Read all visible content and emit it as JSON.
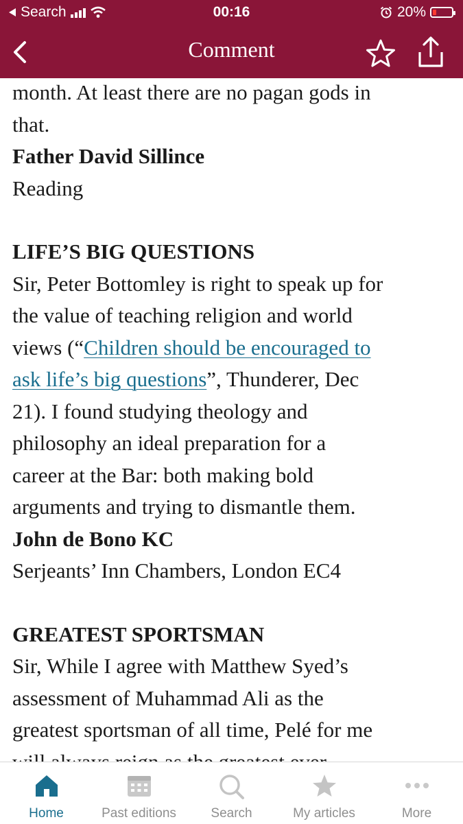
{
  "status_bar": {
    "back_app": "Search",
    "time": "00:16",
    "battery_percent": "20%",
    "battery_level": 0.2,
    "battery_color": "#ff3b30"
  },
  "nav": {
    "title": "Comment",
    "brand_color": "#8a1538"
  },
  "article": {
    "lines_intro": [
      "month. At least there are no pagan gods in",
      "that."
    ],
    "letter1_author": "Father David Sillince",
    "letter1_place": "Reading",
    "section2_heading": "LIFE’S BIG QUESTIONS",
    "section2_line1": "Sir, Peter Bottomley is right to speak up for",
    "section2_line2": "the value of teaching religion and world",
    "section2_line3_pre": "views (“",
    "section2_link_part1": "Children should be encouraged to",
    "section2_link_part2": "ask life’s big questions",
    "section2_line4_post": "”, Thunderer, Dec",
    "section2_line5": "21). I found studying theology and",
    "section2_line6": "philosophy an ideal preparation for a",
    "section2_line7": "career at the Bar: both making bold",
    "section2_line8": "arguments and trying to dismantle them.",
    "letter2_author": "John de Bono KC",
    "letter2_place": "Serjeants’ Inn Chambers, London EC4",
    "section3_heading": "GREATEST SPORTSMAN",
    "section3_line1": "Sir, While I agree with Matthew Syed’s",
    "section3_line2": "assessment of Muhammad Ali as the",
    "section3_line3": "greatest sportsman of all time, Pelé for me",
    "section3_line4": "will always reign as the greatest ever",
    "link_color": "#1a6e8e"
  },
  "tabs": [
    {
      "label": "Home",
      "icon": "home-icon",
      "active": true
    },
    {
      "label": "Past editions",
      "icon": "calendar-icon",
      "active": false
    },
    {
      "label": "Search",
      "icon": "search-icon",
      "active": false
    },
    {
      "label": "My articles",
      "icon": "star-icon",
      "active": false
    },
    {
      "label": "More",
      "icon": "more-icon",
      "active": false
    }
  ]
}
